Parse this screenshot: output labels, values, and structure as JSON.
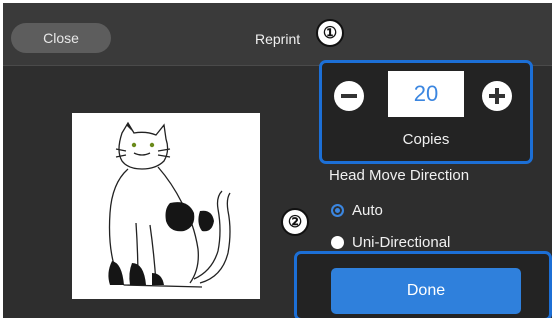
{
  "header": {
    "close_label": "Close",
    "title": "Reprint"
  },
  "callouts": {
    "one": "①",
    "two": "②"
  },
  "copies": {
    "value": "20",
    "label": "Copies",
    "minus_icon": "minus-circle-icon",
    "plus_icon": "plus-circle-icon"
  },
  "head_move": {
    "label": "Head Move Direction",
    "options": [
      {
        "label": "Auto",
        "selected": true
      },
      {
        "label": "Uni-Directional",
        "selected": false
      }
    ]
  },
  "done_label": "Done",
  "colors": {
    "accent": "#2f80dc",
    "highlight_border": "#1c6fd6",
    "background": "#2e2e2e"
  }
}
